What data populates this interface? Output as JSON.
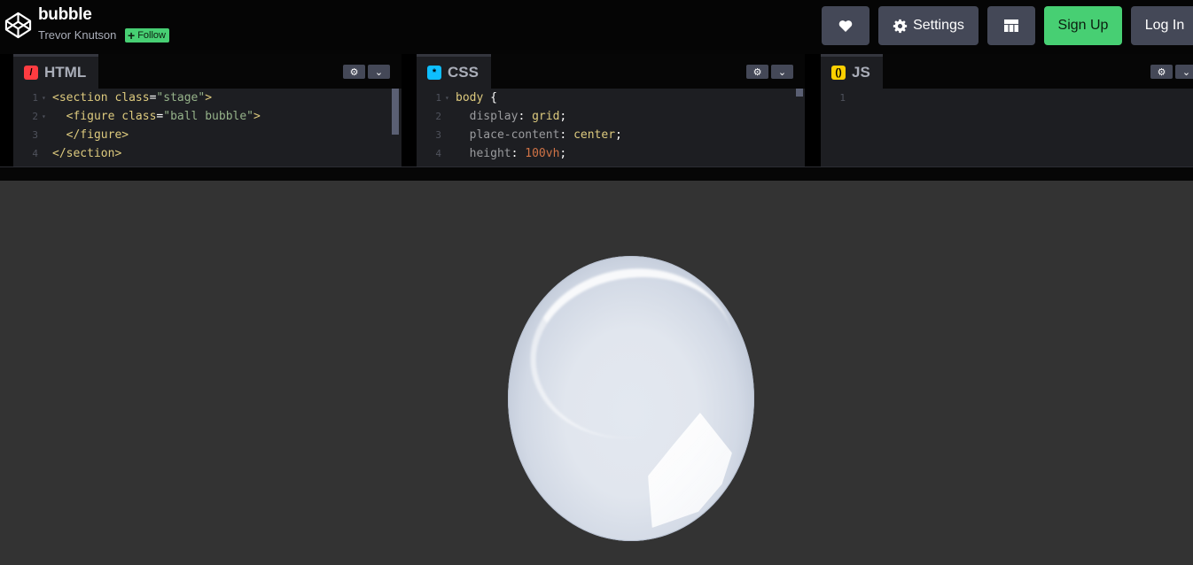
{
  "header": {
    "title": "bubble",
    "author": "Trevor Knutson",
    "follow_label": "Follow",
    "settings_label": "Settings",
    "signup_label": "Sign Up",
    "login_label": "Log In"
  },
  "editors": [
    {
      "name": "HTML",
      "icon": "html-icon",
      "lines": [
        {
          "n": "1",
          "parts": [
            [
              "tag",
              "<section "
            ],
            [
              "attr",
              "class"
            ],
            [
              "punc",
              "="
            ],
            [
              "str",
              "\"stage\""
            ],
            [
              "tag",
              ">"
            ]
          ]
        },
        {
          "n": "2",
          "parts": [
            [
              "tag",
              "  <figure "
            ],
            [
              "attr",
              "class"
            ],
            [
              "punc",
              "="
            ],
            [
              "str",
              "\"ball bubble\""
            ],
            [
              "tag",
              ">"
            ]
          ]
        },
        {
          "n": "3",
          "parts": [
            [
              "tag",
              "  </figure>"
            ]
          ]
        },
        {
          "n": "4",
          "parts": [
            [
              "tag",
              "</section>"
            ]
          ]
        }
      ]
    },
    {
      "name": "CSS",
      "icon": "css-icon",
      "lines": [
        {
          "n": "1",
          "parts": [
            [
              "sel",
              "body "
            ],
            [
              "punc",
              "{"
            ]
          ]
        },
        {
          "n": "2",
          "parts": [
            [
              "prop",
              "  display"
            ],
            [
              "punc",
              ": "
            ],
            [
              "val",
              "grid"
            ],
            [
              "punc",
              ";"
            ]
          ]
        },
        {
          "n": "3",
          "parts": [
            [
              "prop",
              "  place-content"
            ],
            [
              "punc",
              ": "
            ],
            [
              "val",
              "center"
            ],
            [
              "punc",
              ";"
            ]
          ]
        },
        {
          "n": "4",
          "parts": [
            [
              "prop",
              "  height"
            ],
            [
              "punc",
              ": "
            ],
            [
              "num",
              "100vh"
            ],
            [
              "punc",
              ";"
            ]
          ]
        }
      ]
    },
    {
      "name": "JS",
      "icon": "js-icon",
      "lines": [
        {
          "n": "1",
          "parts": []
        }
      ]
    }
  ]
}
